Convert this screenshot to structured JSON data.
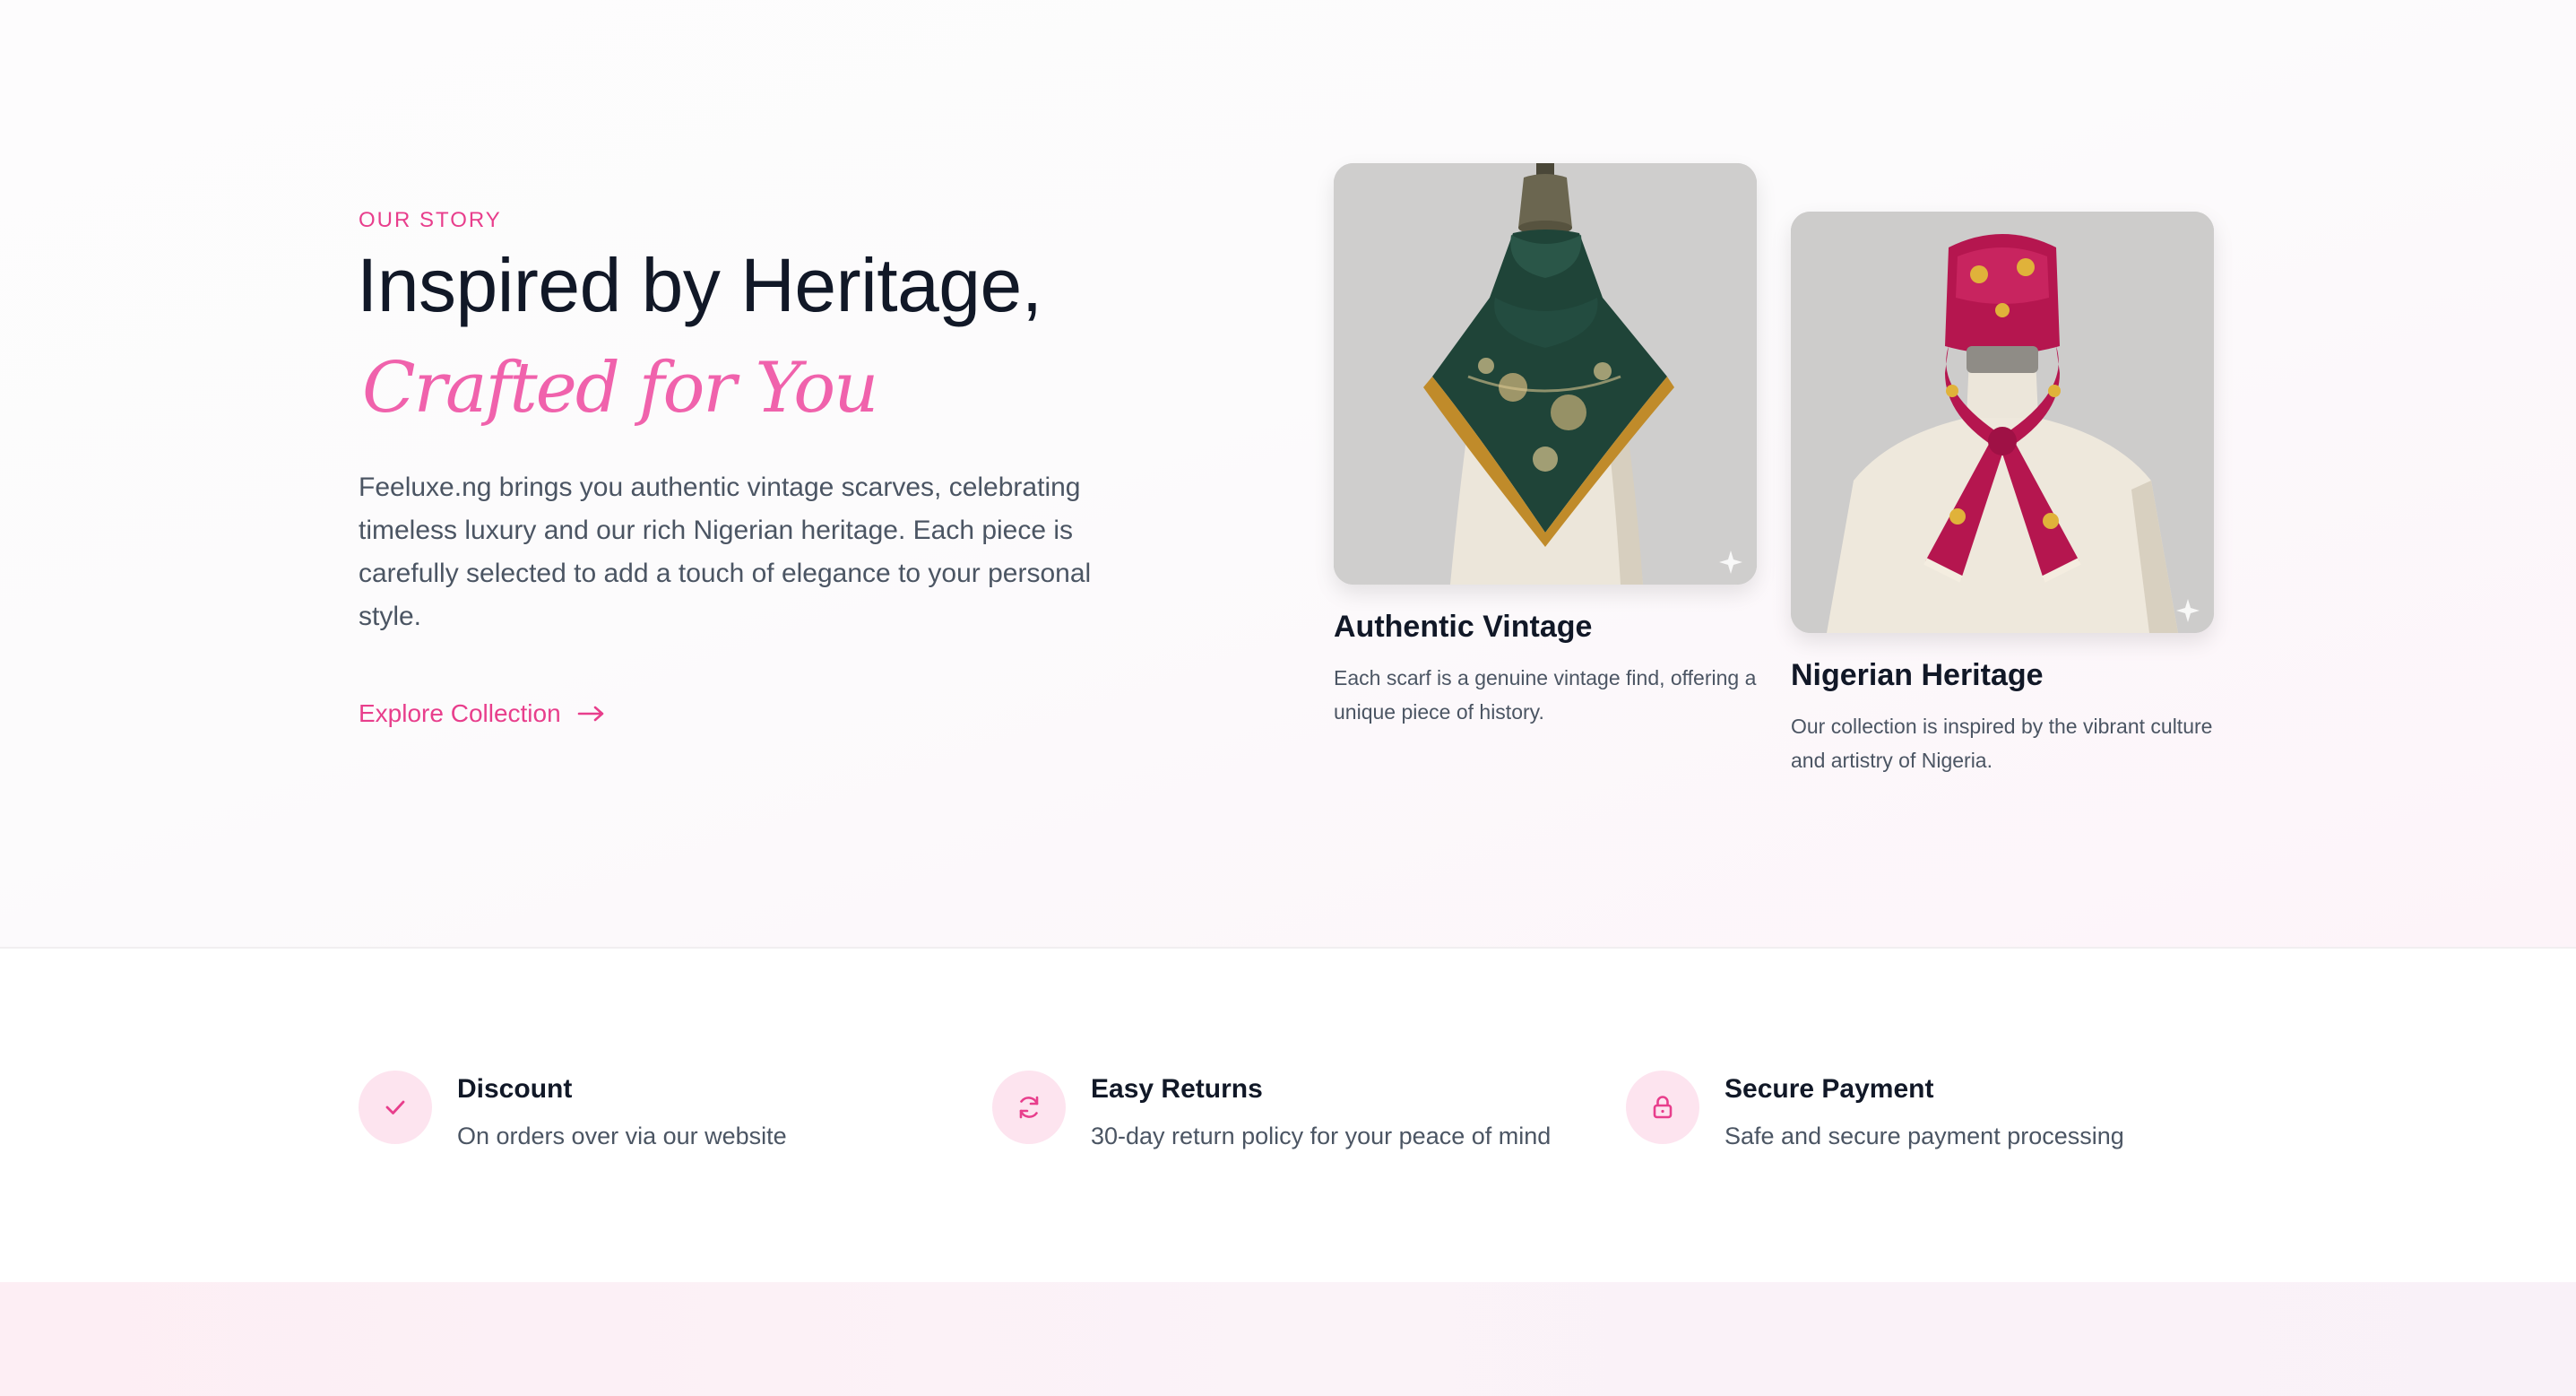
{
  "story": {
    "eyebrow": "OUR STORY",
    "headline": "Inspired by Heritage,",
    "headline_accent": "Crafted for You",
    "description": "Feeluxe.ng brings you authentic vintage scarves, celebrating timeless luxury and our rich Nigerian heritage. Each piece is carefully selected to add a touch of elegance to your personal style.",
    "cta_label": "Explore Collection",
    "cards": [
      {
        "title": "Authentic Vintage",
        "text": "Each scarf is a genuine vintage find, offering a unique piece of history.",
        "image_icon": "green-paisley-scarf-on-mannequin"
      },
      {
        "title": "Nigerian Heritage",
        "text": "Our collection is inspired by the vibrant culture and artistry of Nigeria.",
        "image_icon": "magenta-gold-scarf-on-mannequin"
      }
    ]
  },
  "features": [
    {
      "icon": "check-icon",
      "title": "Discount",
      "text": "On orders over via our website"
    },
    {
      "icon": "refresh-icon",
      "title": "Easy Returns",
      "text": "30-day return policy for your peace of mind"
    },
    {
      "icon": "lock-icon",
      "title": "Secure Payment",
      "text": "Safe and secure payment processing"
    }
  ],
  "colors": {
    "accent": "#e83e8c",
    "accent_light": "#f062ac",
    "badge_bg": "#fde4ef",
    "heading": "#111827",
    "body_text": "#4b5563"
  }
}
